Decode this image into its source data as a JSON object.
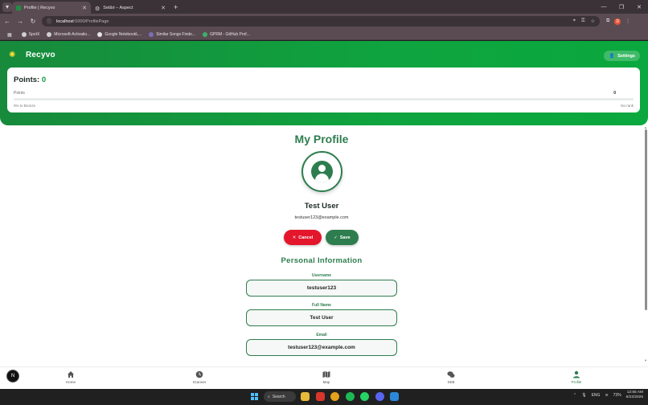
{
  "browser": {
    "tabs": [
      {
        "title": "Profile | Recyvo",
        "active": true
      },
      {
        "title": "Setări – Aspect",
        "active": false
      }
    ],
    "url_host": "localhost",
    "url_path": ":5000/ProfilePage",
    "bookmarks": [
      "SpotX",
      "Microsoft-Activatio...",
      "Google NotebookL...",
      "Similar Songs Finde...",
      "GPRM - GitHub Prof..."
    ],
    "profile_badge": "D"
  },
  "app": {
    "brand": "Recyvo",
    "settings_label": "Settings",
    "points": {
      "title": "Points:",
      "value": "0",
      "label": "Points",
      "count": "0",
      "progress_text": "0% to Bronze",
      "progress_percent": 0,
      "rank_text": "No rank"
    },
    "profile": {
      "title": "My Profile",
      "name": "Test User",
      "email": "testuser123@example.com",
      "cancel_label": "Cancel",
      "save_label": "Save"
    },
    "personal_info": {
      "title": "Personal Information",
      "fields": [
        {
          "label": "Username",
          "value": "testuser123"
        },
        {
          "label": "Full Name",
          "value": "Test User"
        },
        {
          "label": "Email",
          "value": "testuser123@example.com"
        }
      ]
    },
    "nav": [
      {
        "label": "Home",
        "active": false
      },
      {
        "label": "Scanner",
        "active": false
      },
      {
        "label": "Map",
        "active": false
      },
      {
        "label": "SEB",
        "active": false
      },
      {
        "label": "Profile",
        "active": true
      }
    ],
    "fab_label": "N"
  },
  "taskbar": {
    "search_label": "Search",
    "lang": "ENG",
    "battery": "73%",
    "time": "12:55 AM",
    "date": "6/22/2026"
  },
  "colors": {
    "brand_green": "#0fa43f",
    "primary_green": "#2e7d4f",
    "danger_red": "#e3162b"
  }
}
